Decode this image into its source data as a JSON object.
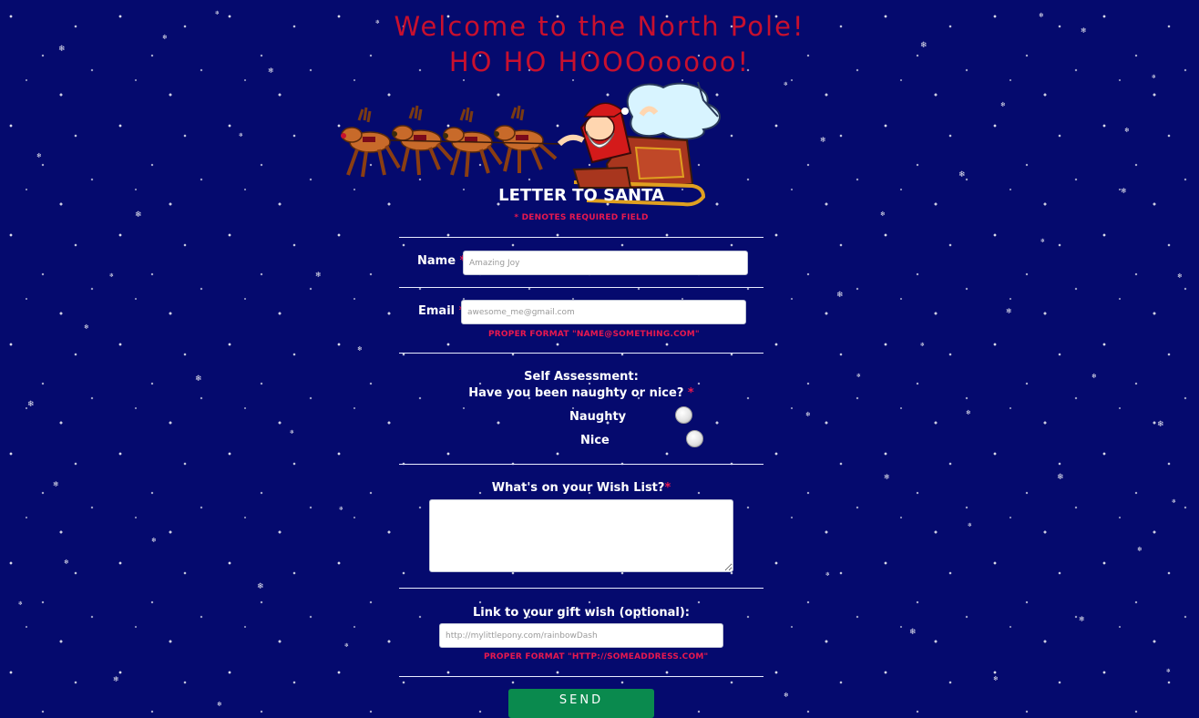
{
  "header": {
    "line1": "Welcome to the North Pole!",
    "line2": "HO HO HOOOooooo!"
  },
  "form": {
    "title": "LETTER TO SANTA",
    "required_note": "* DENOTES REQUIRED FIELD",
    "required_marker": "*",
    "name": {
      "label": "Name",
      "placeholder": "Amazing Joy"
    },
    "email": {
      "label": "Email",
      "placeholder": "awesome_me@gmail.com",
      "hint": "PROPER FORMAT \"NAME@SOMETHING.COM\""
    },
    "self_assessment": {
      "heading": "Self Assessment:",
      "question": "Have you been naughty or nice?",
      "options": [
        "Naughty",
        "Nice"
      ]
    },
    "wish_list": {
      "label": "What's on your Wish List?"
    },
    "gift_link": {
      "label": "Link to your gift wish (optional):",
      "placeholder": "http://mylittlepony.com/rainbowDash",
      "hint": "PROPER FORMAT \"HTTP://SOMEADDRESS.COM\""
    },
    "submit_label": "SEND"
  },
  "colors": {
    "background": "#050a6e",
    "header_text": "#c8102e",
    "required_red": "#e8184f",
    "send_button": "#0a8a4e"
  },
  "icons": {
    "snowflake": "snowflake-icon",
    "santa_sleigh": "santa-sleigh-reindeer-illustration"
  }
}
